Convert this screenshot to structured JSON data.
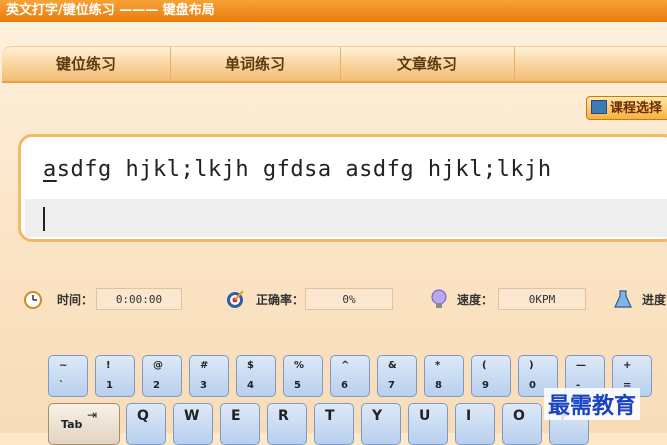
{
  "window": {
    "title": "英文打字/键位练习 ——— 键盘布局"
  },
  "tabs": [
    {
      "label": "键位练习"
    },
    {
      "label": "单词练习"
    },
    {
      "label": "文章练习"
    },
    {
      "label": ""
    }
  ],
  "course_button": {
    "label": "课程选择"
  },
  "practice": {
    "first_char": "a",
    "rest_text": "sdfg hjkl;lkjh gfdsa asdfg hjkl;lkjh",
    "input_value": ""
  },
  "stats": {
    "time": {
      "label": "时间：",
      "value": "0:00:00"
    },
    "accuracy": {
      "label": "正确率：",
      "value": "0%"
    },
    "speed": {
      "label": "速度：",
      "value": "0KPM"
    },
    "progress": {
      "label": "进度"
    }
  },
  "keyboard": {
    "number_row": [
      {
        "top": "~",
        "bottom": "`"
      },
      {
        "top": "!",
        "bottom": "1"
      },
      {
        "top": "@",
        "bottom": "2"
      },
      {
        "top": "#",
        "bottom": "3"
      },
      {
        "top": "$",
        "bottom": "4"
      },
      {
        "top": "%",
        "bottom": "5"
      },
      {
        "top": "^",
        "bottom": "6"
      },
      {
        "top": "&",
        "bottom": "7"
      },
      {
        "top": "*",
        "bottom": "8"
      },
      {
        "top": "(",
        "bottom": "9"
      },
      {
        "top": ")",
        "bottom": "0"
      },
      {
        "top": "—",
        "bottom": "-"
      },
      {
        "top": "+",
        "bottom": "="
      }
    ],
    "tab_key": {
      "label": "Tab",
      "arrow": "⇥"
    },
    "letter_row": [
      "Q",
      "W",
      "E",
      "R",
      "T",
      "Y",
      "U",
      "I",
      "O",
      "P"
    ]
  },
  "watermark": {
    "text": "最需教育"
  },
  "colors": {
    "title_bar": "#ea7b0e",
    "key_fill": "#b8cfee",
    "watermark": "#1843c2"
  }
}
